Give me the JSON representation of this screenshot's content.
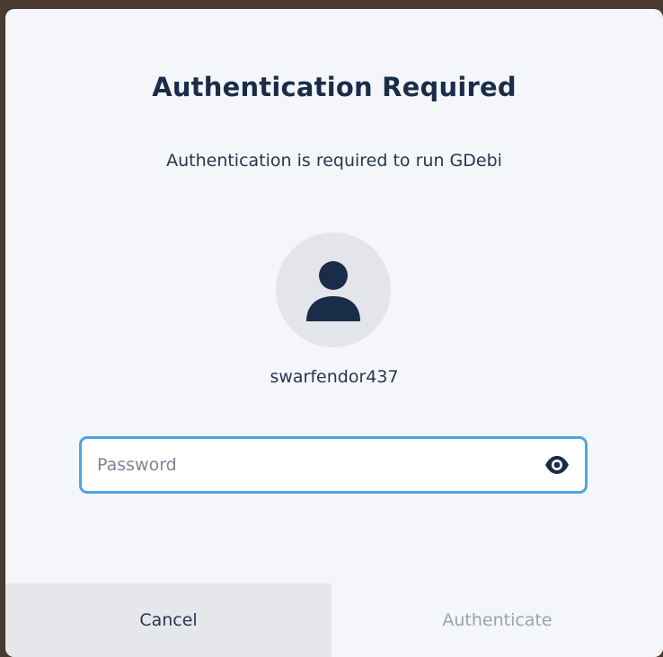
{
  "dialog": {
    "title": "Authentication Required",
    "subtitle": "Authentication is required to run GDebi",
    "avatar_icon": "user-icon",
    "username": "swarfendor437",
    "password": {
      "value": "",
      "placeholder": "Password",
      "reveal_icon": "eye-icon"
    },
    "buttons": {
      "cancel_label": "Cancel",
      "authenticate_label": "Authenticate"
    }
  },
  "colors": {
    "title": "#1a2d48",
    "focus_border": "#4ba6e0",
    "dialog_bg": "#f5f6fa",
    "disabled_text": "#9aa2ad"
  }
}
